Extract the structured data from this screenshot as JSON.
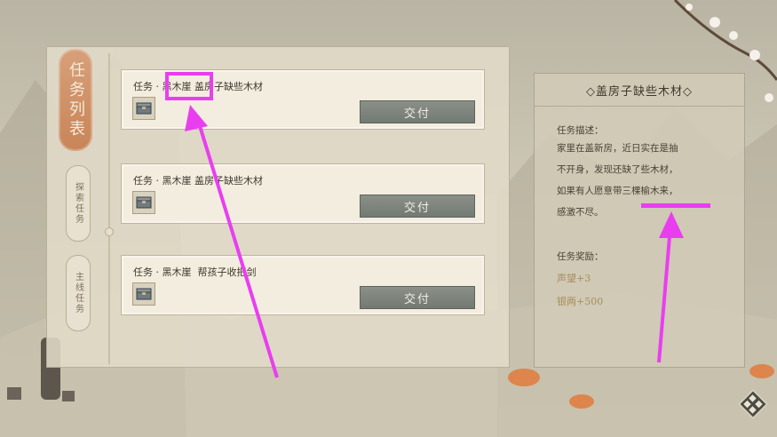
{
  "tabs": {
    "active": "任务列表",
    "explore": "探索任务",
    "main": "主线任务"
  },
  "quests": [
    {
      "title": "任务 · 黑木崖 盖房子缺些木材",
      "button": "交付"
    },
    {
      "title": "任务 · 黑木崖 盖房子缺些木材",
      "button": "交付"
    },
    {
      "title": "任务 · 黑木崖  帮孩子收把剑",
      "button": "交付"
    }
  ],
  "detail": {
    "title": "◇盖房子缺些木材◇",
    "desc_label": "任务描述：",
    "desc_lines": [
      "家里在盖新房，近日实在是抽",
      "不开身，发现还缺了些木材，",
      "如果有人愿意带三棵榆木来，",
      "感激不尽。"
    ],
    "reward_label": "任务奖励：",
    "rewards": [
      "声望+3",
      "银两+500"
    ]
  },
  "colors": {
    "annotation": "#e93ef0",
    "tab_active": "#c88458",
    "button": "#737a73",
    "reward_text": "#a88d5b"
  },
  "icons": [
    "chest-icon",
    "diamond-menu-icon"
  ]
}
